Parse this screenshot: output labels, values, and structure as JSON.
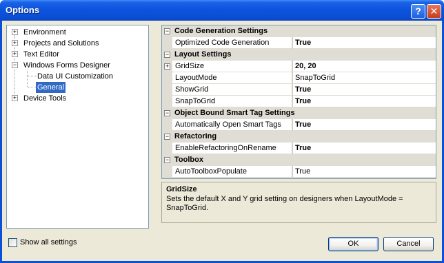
{
  "window": {
    "title": "Options",
    "help_glyph": "?",
    "close_glyph": "✕"
  },
  "tree": {
    "items": [
      {
        "label": "Environment",
        "expander": "+"
      },
      {
        "label": "Projects and Solutions",
        "expander": "+"
      },
      {
        "label": "Text Editor",
        "expander": "+"
      },
      {
        "label": "Windows Forms Designer",
        "expander": "−"
      },
      {
        "label": "Data UI Customization"
      },
      {
        "label": "General",
        "selected": true
      },
      {
        "label": "Device Tools",
        "expander": "+"
      }
    ]
  },
  "grid": {
    "categories": [
      {
        "label": "Code Generation Settings",
        "toggle": "−",
        "props": [
          {
            "name": "Optimized Code Generation",
            "value": "True",
            "bold": true
          }
        ]
      },
      {
        "label": "Layout Settings",
        "toggle": "−",
        "props": [
          {
            "name": "GridSize",
            "value": "20, 20",
            "bold": true,
            "expander": "+"
          },
          {
            "name": "LayoutMode",
            "value": "SnapToGrid",
            "bold": false
          },
          {
            "name": "ShowGrid",
            "value": "True",
            "bold": true
          },
          {
            "name": "SnapToGrid",
            "value": "True",
            "bold": true
          }
        ]
      },
      {
        "label": "Object Bound Smart Tag Settings",
        "toggle": "−",
        "props": [
          {
            "name": "Automatically Open Smart Tags",
            "value": "True",
            "bold": true
          }
        ]
      },
      {
        "label": "Refactoring",
        "toggle": "−",
        "props": [
          {
            "name": "EnableRefactoringOnRename",
            "value": "True",
            "bold": true
          }
        ]
      },
      {
        "label": "Toolbox",
        "toggle": "−",
        "props": [
          {
            "name": "AutoToolboxPopulate",
            "value": "True",
            "bold": false
          }
        ]
      }
    ]
  },
  "description": {
    "title": "GridSize",
    "text": "Sets the default X and Y grid setting on designers when LayoutMode = SnapToGrid."
  },
  "footer": {
    "show_all_label": "Show all settings",
    "show_all_checked": false,
    "ok_label": "OK",
    "cancel_label": "Cancel"
  },
  "colors": {
    "titlebar": "#0c54dd",
    "selection": "#316ac5",
    "dialog_bg": "#ece9d8"
  }
}
